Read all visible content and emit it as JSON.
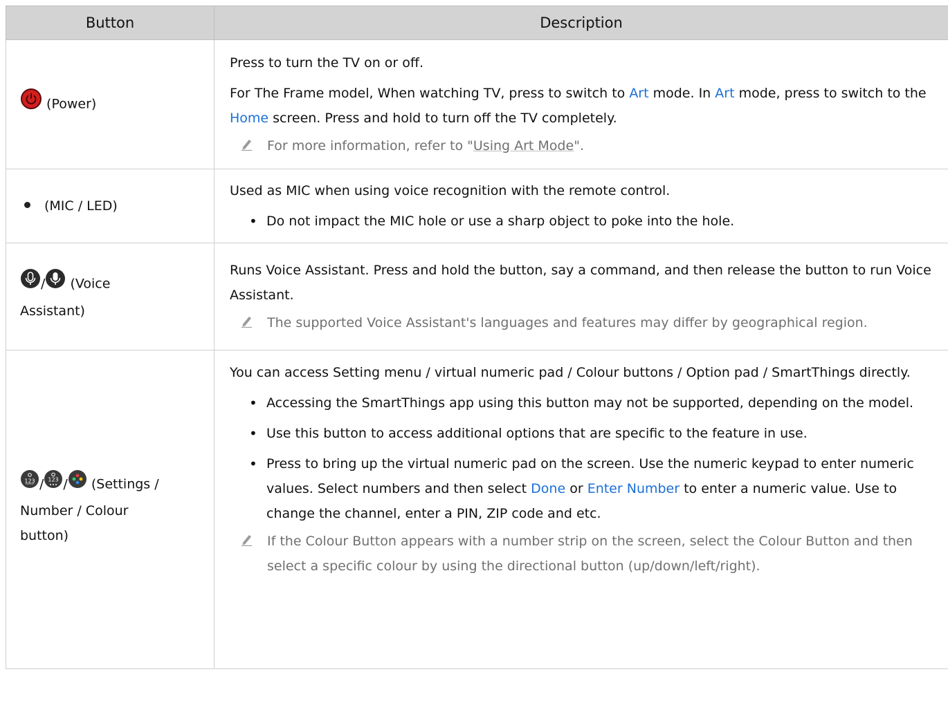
{
  "header": {
    "col_button": "Button",
    "col_description": "Description"
  },
  "rows": [
    {
      "button_label": "(Power)",
      "icon": "power-icon",
      "description": [
        "Press to turn the TV on or off.",
        {
          "pre": "For The Frame model, When watching TV, press to switch to ",
          "link1": "Art",
          "mid1": " mode. In ",
          "link2": "Art",
          "mid2": " mode, press to switch to the ",
          "link3": "Home",
          "post": " screen. Press and hold to turn off the TV completely."
        }
      ],
      "note": {
        "pre": "For more information, refer to \"",
        "link": "Using Art Mode",
        "post": "\"."
      }
    },
    {
      "button_label": "(MIC / LED)",
      "icon": "mic-led-dot-icon",
      "description": [
        "Used as MIC when using voice recognition with the remote control."
      ],
      "bullets": [
        "Do not impact the MIC hole or use a sharp object to poke into the hole."
      ]
    },
    {
      "button_label_line1": "(Voice",
      "button_label_line2": "Assistant)",
      "separator": "/",
      "icon": "microphone-icon",
      "description": [
        "Runs Voice Assistant. Press and hold the button, say a command, and then release the button to run Voice Assistant."
      ],
      "note": "The supported Voice Assistant's languages and features may differ by geographical region."
    },
    {
      "button_label_line1": "(Settings /",
      "button_label_line2": "Number / Colour",
      "button_label_line3": "button)",
      "separator": "/",
      "icon": "settings-number-colour-icon",
      "description": [
        "You can access Setting menu / virtual numeric pad / Colour buttons / Option pad / SmartThings directly."
      ],
      "bullets": [
        "Accessing the SmartThings app using this button may not be supported, depending on the model.",
        "Use this button to access additional options that are specific to the feature in use."
      ],
      "bullet3": {
        "pre": "Press to bring up the virtual numeric pad on the screen. Use the numeric keypad to enter numeric values. Select numbers and then select ",
        "link1": "Done",
        "mid": " or ",
        "link2": "Enter Number",
        "post": " to enter a numeric value. Use to change the channel, enter a PIN, ZIP code and etc."
      },
      "note": "If the Colour Button appears with a number strip on the screen, select the Colour Button and then select a specific colour by using the directional button (up/down/left/right)."
    }
  ],
  "colors": {
    "link": "#1a6fd9",
    "header_bg": "#d3d3d3",
    "power_red": "#d21f1f",
    "note_gray": "#707070"
  }
}
